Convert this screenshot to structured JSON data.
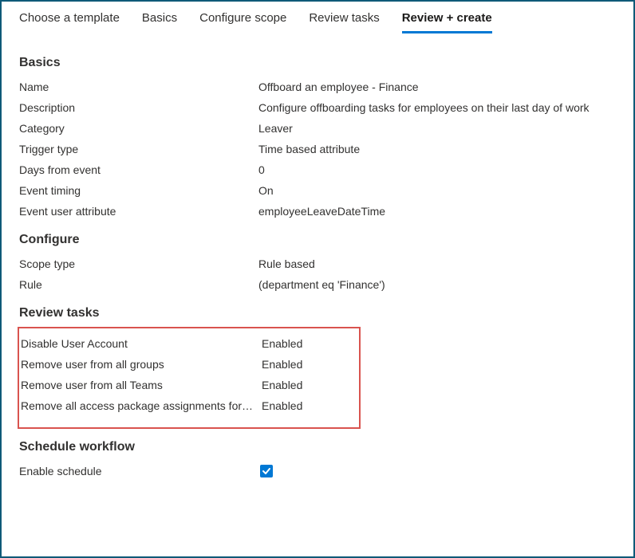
{
  "tabs": {
    "choose_template": "Choose a template",
    "basics": "Basics",
    "configure_scope": "Configure scope",
    "review_tasks": "Review tasks",
    "review_create": "Review + create"
  },
  "sections": {
    "basics_title": "Basics",
    "configure_title": "Configure",
    "review_tasks_title": "Review tasks",
    "schedule_title": "Schedule workflow"
  },
  "basics": {
    "name_label": "Name",
    "name_value": "Offboard an employee - Finance",
    "description_label": "Description",
    "description_value": "Configure offboarding tasks for employees on their last day of work",
    "category_label": "Category",
    "category_value": "Leaver",
    "trigger_type_label": "Trigger type",
    "trigger_type_value": "Time based attribute",
    "days_from_event_label": "Days from event",
    "days_from_event_value": "0",
    "event_timing_label": "Event timing",
    "event_timing_value": "On",
    "event_user_attribute_label": "Event user attribute",
    "event_user_attribute_value": "employeeLeaveDateTime"
  },
  "configure": {
    "scope_type_label": "Scope type",
    "scope_type_value": "Rule based",
    "rule_label": "Rule",
    "rule_value": " (department eq 'Finance')"
  },
  "tasks": [
    {
      "name": "Disable User Account",
      "status": "Enabled"
    },
    {
      "name": "Remove user from all groups",
      "status": "Enabled"
    },
    {
      "name": "Remove user from all Teams",
      "status": "Enabled"
    },
    {
      "name": "Remove all access package assignments for user",
      "status": "Enabled"
    }
  ],
  "schedule": {
    "enable_label": "Enable schedule",
    "enabled": true
  }
}
